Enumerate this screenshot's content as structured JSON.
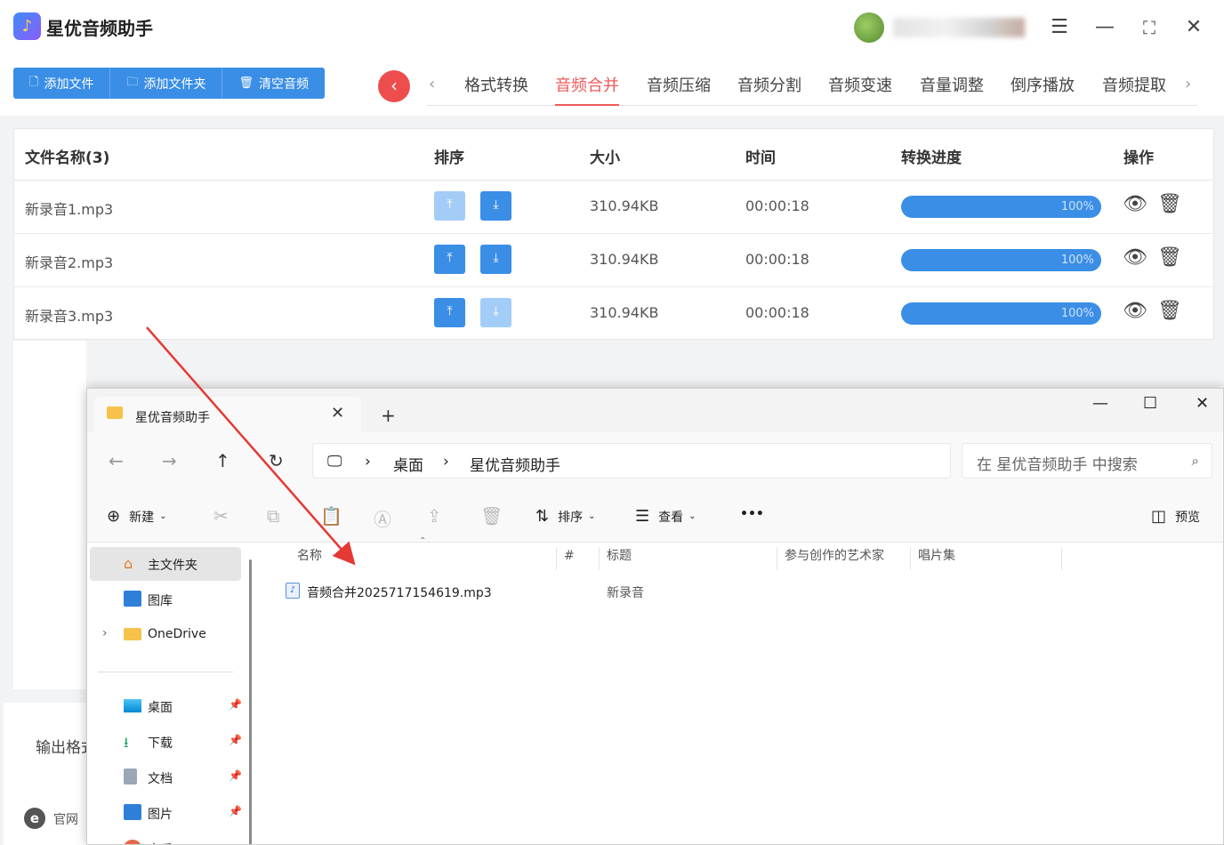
{
  "app": {
    "title": "星优音频助手",
    "user_name": "",
    "logo_glyph": "♪"
  },
  "toolbar": {
    "add_file": "添加文件",
    "add_folder": "添加文件夹",
    "clear_audio": "清空音频"
  },
  "tabs": [
    "格式转换",
    "音频合并",
    "音频压缩",
    "音频分割",
    "音频变速",
    "音量调整",
    "倒序播放",
    "音频提取"
  ],
  "active_tab": "音频合并",
  "table": {
    "headers": {
      "name": "文件名称(3)",
      "sort": "排序",
      "size": "大小",
      "time": "时间",
      "progress": "转换进度",
      "ops": "操作"
    },
    "rows": [
      {
        "name": "新录音1.mp3",
        "size": "310.94KB",
        "time": "00:00:18",
        "progress": "100%",
        "up_enabled": false,
        "down_enabled": true
      },
      {
        "name": "新录音2.mp3",
        "size": "310.94KB",
        "time": "00:00:18",
        "progress": "100%",
        "up_enabled": true,
        "down_enabled": true
      },
      {
        "name": "新录音3.mp3",
        "size": "310.94KB",
        "time": "00:00:18",
        "progress": "100%",
        "up_enabled": true,
        "down_enabled": false
      }
    ]
  },
  "bottom": {
    "output_label": "输出格式",
    "site_label": "官网"
  },
  "explorer": {
    "tab_title": "星优音频助手",
    "breadcrumb": [
      "桌面",
      "星优音频助手"
    ],
    "search_placeholder": "在 星优音频助手 中搜索",
    "commands": {
      "new": "新建",
      "sort": "排序",
      "view": "查看",
      "more": "•••",
      "preview": "预览"
    },
    "sidebar": [
      {
        "label": "主文件夹",
        "icon": "home-icon"
      },
      {
        "label": "图库",
        "icon": "gallery-icon"
      },
      {
        "label": "OneDrive",
        "icon": "folder-icon"
      },
      {
        "label": "桌面",
        "icon": "desktop-icon"
      },
      {
        "label": "下载",
        "icon": "download-icon"
      },
      {
        "label": "文档",
        "icon": "document-icon"
      },
      {
        "label": "图片",
        "icon": "pictures-icon"
      },
      {
        "label": "音乐",
        "icon": "music-icon"
      }
    ],
    "columns": {
      "name": "名称",
      "number": "#",
      "title": "标题",
      "artist": "参与创作的艺术家",
      "album": "唱片集"
    },
    "files": [
      {
        "name": "音频合并2025717154619.mp3",
        "title": "新录音"
      }
    ]
  },
  "colors": {
    "primary": "#3a8ee6",
    "accent_red": "#ee5a5a"
  }
}
